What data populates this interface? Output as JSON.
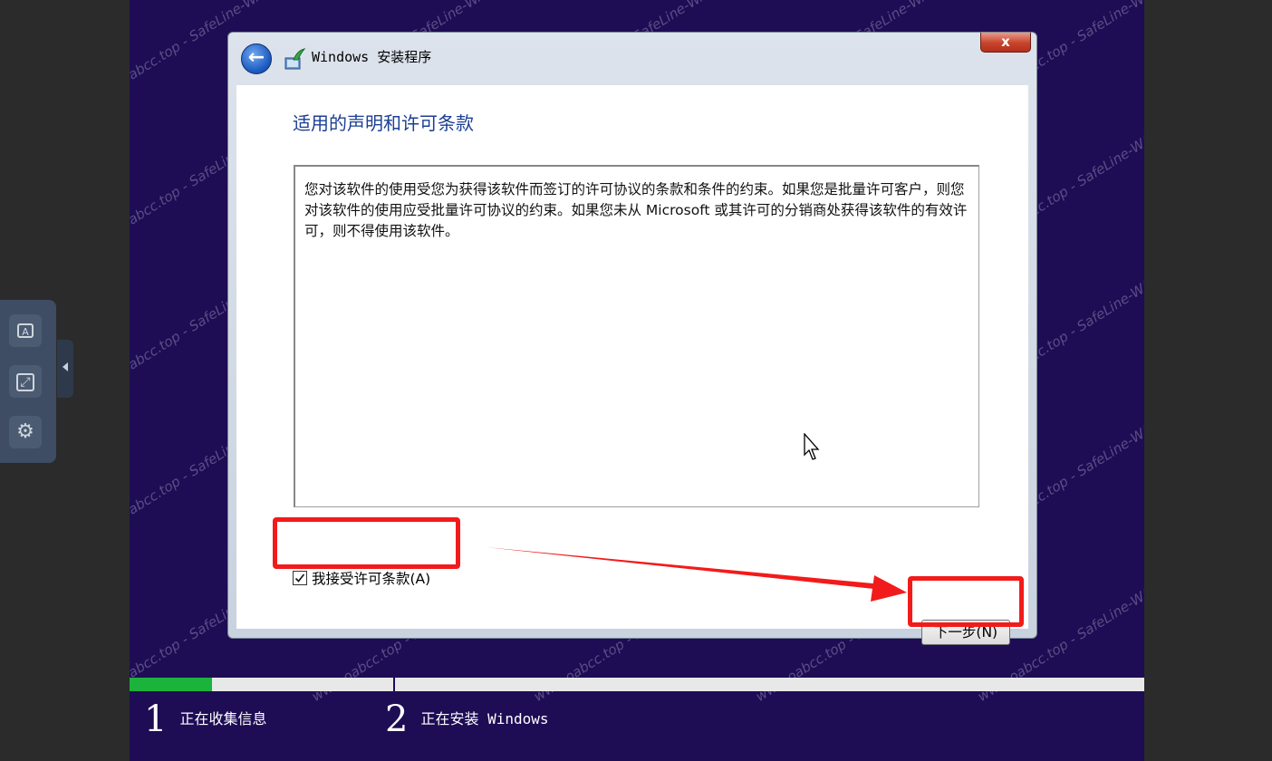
{
  "dialog": {
    "title": "Windows 安装程序",
    "close_label": "x",
    "heading": "适用的声明和许可条款",
    "license_text": "您对该软件的使用受您为获得该软件而签订的许可协议的条款和条件的约束。如果您是批量许可客户，则您对该软件的使用应受批量许可协议的约束。如果您未从 Microsoft 或其许可的分销商处获得该软件的有效许可，则不得使用该软件。",
    "accept_label": "我接受许可条款(A)",
    "accept_checked": true,
    "next_label": "下一步(N)"
  },
  "progress": {
    "fraction": 0.081,
    "steps": [
      {
        "number": "1",
        "label": "正在收集信息"
      },
      {
        "number": "2",
        "label": "正在安装 Windows"
      }
    ]
  },
  "watermark_text": "www.oabcc.top - SafeLine-WAF",
  "tool_panel": {
    "buttons": [
      {
        "icon": "keyboard-a-icon",
        "glyph": "A"
      },
      {
        "icon": "fullscreen-icon",
        "glyph": "⤢"
      },
      {
        "icon": "gear-icon",
        "glyph": "⚙"
      }
    ]
  },
  "colors": {
    "vm_background": "#1e0c55",
    "highlight": "#f21b1b",
    "progress_fill": "#1bb33c",
    "heading": "#1c3f94"
  }
}
